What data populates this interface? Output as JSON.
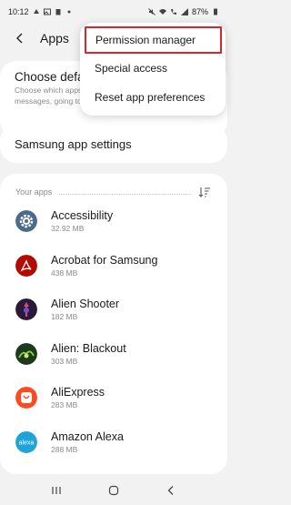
{
  "status_bar": {
    "time": "10:12",
    "battery": "87%"
  },
  "header": {
    "title": "Apps"
  },
  "default_apps": {
    "title": "Choose default apps",
    "subtitle_line1": "Choose which apps to use for calls,",
    "subtitle_line2": "messages, going to websites, and more"
  },
  "samsung_settings": {
    "title": "Samsung app settings"
  },
  "apps_list": {
    "section_label": "Your apps",
    "items": [
      {
        "name": "Accessibility",
        "size": "32.92 MB",
        "icon": "gear-icon",
        "color": "#4a6b8a"
      },
      {
        "name": "Acrobat for Samsung",
        "size": "438 MB",
        "icon": "acrobat-icon",
        "color": "#b30b00"
      },
      {
        "name": "Alien Shooter",
        "size": "182 MB",
        "icon": "alien-shooter-icon",
        "color": "#2a1a3a"
      },
      {
        "name": "Alien: Blackout",
        "size": "303 MB",
        "icon": "alien-blackout-icon",
        "color": "#1e3a1e"
      },
      {
        "name": "AliExpress",
        "size": "283 MB",
        "icon": "aliexpress-icon",
        "color": "#ff4a1f"
      },
      {
        "name": "Amazon Alexa",
        "size": "288 MB",
        "icon": "alexa-icon",
        "color": "#1fa3d8"
      }
    ]
  },
  "menu": {
    "items": [
      {
        "label": "Permission manager"
      },
      {
        "label": "Special access"
      },
      {
        "label": "Reset app preferences"
      }
    ],
    "highlight_color": "#d9262c"
  }
}
